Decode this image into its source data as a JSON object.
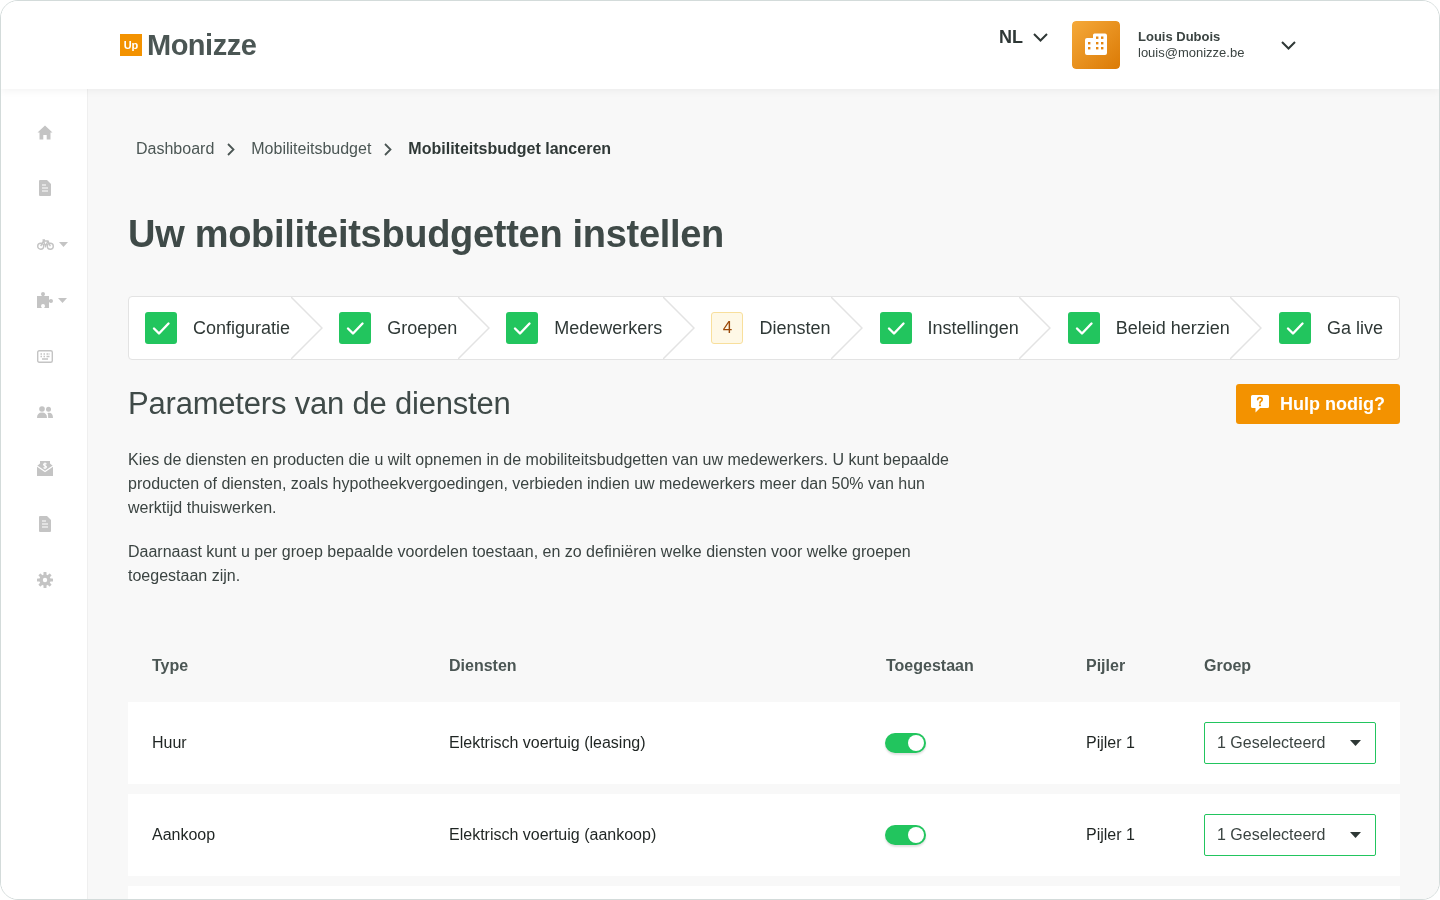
{
  "header": {
    "logo": {
      "badge": "Up",
      "name": "Monizze"
    },
    "language": "NL",
    "user": {
      "name": "Louis Dubois",
      "email": "louis@monizze.be"
    }
  },
  "breadcrumb": [
    {
      "label": "Dashboard",
      "current": false
    },
    {
      "label": "Mobiliteitsbudget",
      "current": false
    },
    {
      "label": "Mobiliteitsbudget lanceren",
      "current": true
    }
  ],
  "title": "Uw mobiliteitsbudgetten instellen",
  "steps": [
    {
      "label": "Configuratie",
      "completed": true
    },
    {
      "label": "Groepen",
      "completed": true
    },
    {
      "label": "Medewerkers",
      "completed": true
    },
    {
      "label": "Diensten",
      "completed": false,
      "number": "4"
    },
    {
      "label": "Instellingen",
      "completed": true
    },
    {
      "label": "Beleid herzien",
      "completed": true
    },
    {
      "label": "Ga live",
      "completed": true
    }
  ],
  "section": {
    "title": "Parameters van de diensten",
    "help_button": "Hulp nodig?",
    "paragraphs": [
      "Kies de diensten en producten die u wilt opnemen in de mobiliteitsbudgetten van uw medewerkers. U kunt bepaalde producten of diensten, zoals hypotheekvergoedingen, verbieden indien uw medewerkers meer dan 50% van hun werktijd thuiswerken.",
      "Daarnaast kunt u per groep bepaalde voordelen toestaan, en zo definiëren welke diensten voor welke groepen toegestaan zijn."
    ]
  },
  "table": {
    "columns": [
      "Type",
      "Diensten",
      "Toegestaan",
      "Pijler",
      "Groep"
    ],
    "rows": [
      {
        "type": "Huur",
        "service": "Elektrisch voertuig (leasing)",
        "allowed": true,
        "pillar": "Pijler 1",
        "group": "1 Geselecteerd"
      },
      {
        "type": "Aankoop",
        "service": "Elektrisch voertuig (aankoop)",
        "allowed": true,
        "pillar": "Pijler 1",
        "group": "1 Geselecteerd"
      }
    ]
  }
}
